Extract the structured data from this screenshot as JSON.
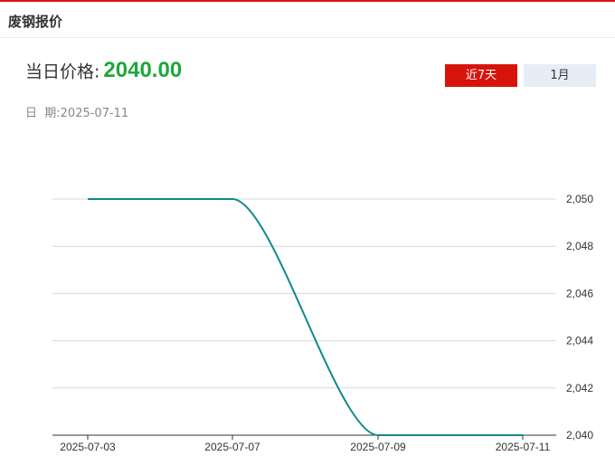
{
  "header": {
    "title": "废钢报价"
  },
  "price": {
    "label": "当日价格:",
    "value": "2040.00"
  },
  "date": {
    "label": "日  期:",
    "value": "2025-07-11"
  },
  "tabs": [
    {
      "label": "近7天",
      "active": true
    },
    {
      "label": "1月",
      "active": false
    }
  ],
  "colors": {
    "accent_red": "#d7140c",
    "price_green": "#1ca83c",
    "line": "#0f8a8a",
    "tab_inactive": "#e6edf6"
  },
  "chart_data": {
    "type": "line",
    "x": [
      "2025-07-03",
      "2025-07-07",
      "2025-07-09",
      "2025-07-11"
    ],
    "series": [
      {
        "values": [
          2050,
          2050,
          2040,
          2040
        ]
      }
    ],
    "x_ticks": [
      "2025-07-03",
      "2025-07-07",
      "2025-07-09",
      "2025-07-11"
    ],
    "y_ticks": [
      2040,
      2042,
      2044,
      2046,
      2048,
      2050
    ],
    "y_tick_labels": [
      "2,040",
      "2,042",
      "2,044",
      "2,046",
      "2,048",
      "2,050"
    ],
    "ylim": [
      2040,
      2050
    ],
    "grid": true,
    "y_axis_side": "right"
  }
}
